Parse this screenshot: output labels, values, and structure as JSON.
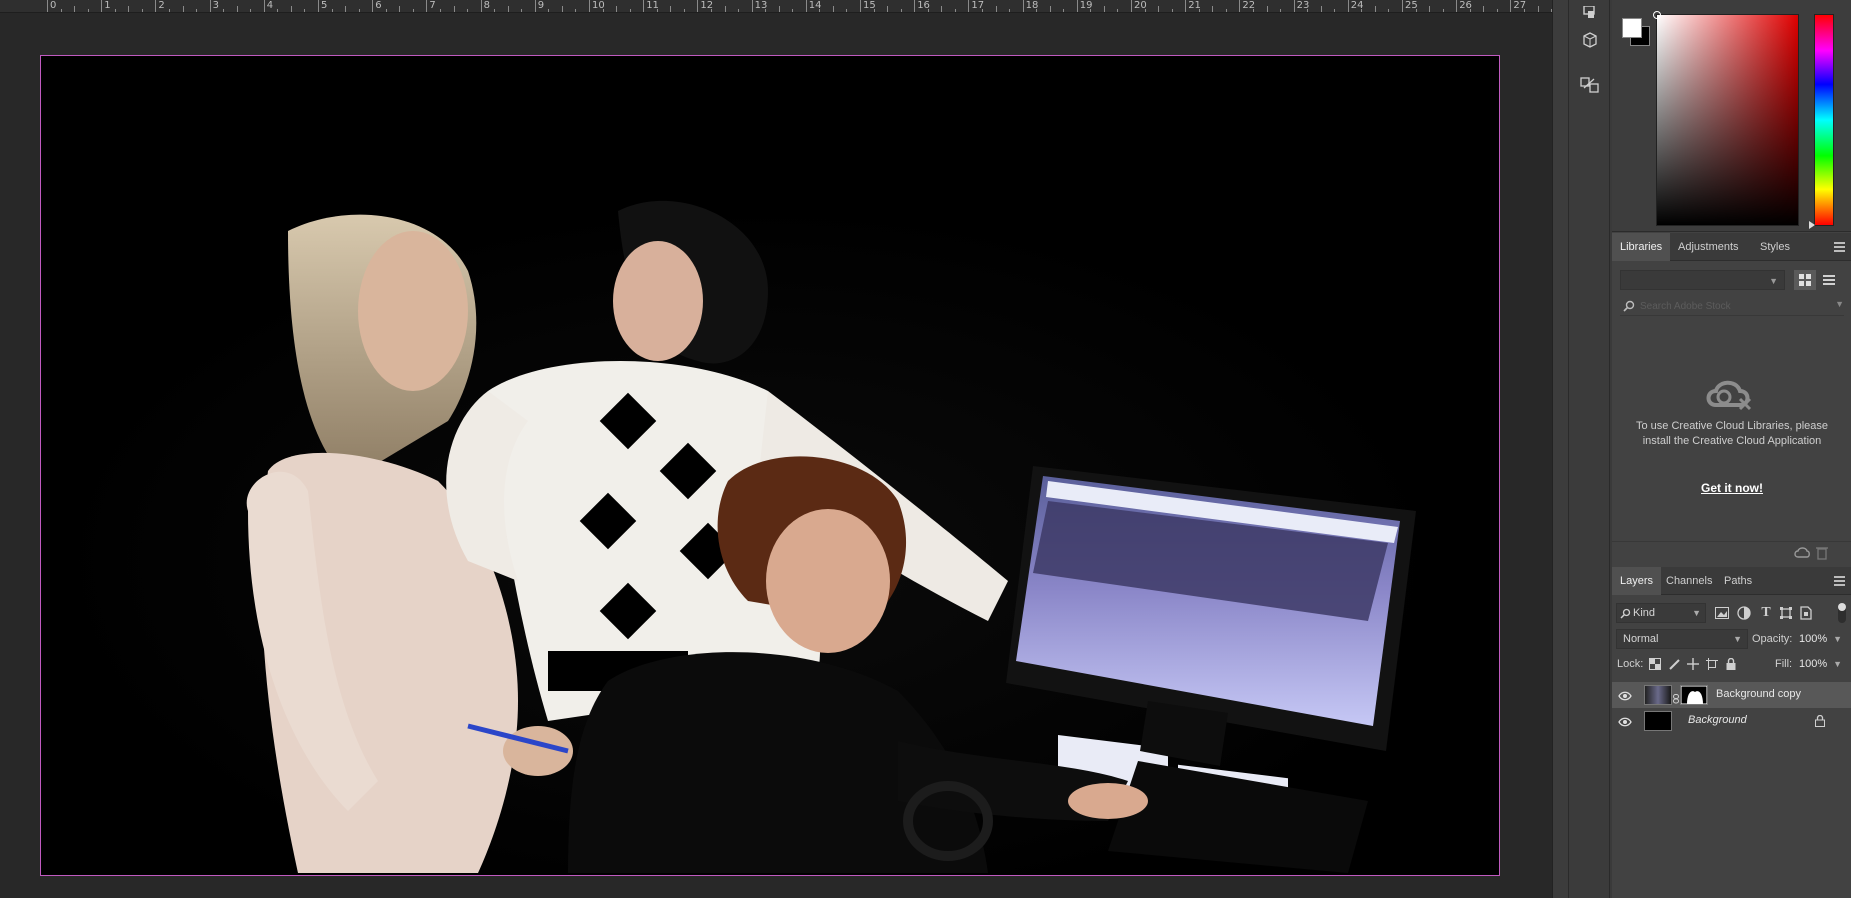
{
  "ruler": {
    "numbers": [
      "0",
      "1",
      "2",
      "3",
      "4",
      "5",
      "6",
      "7",
      "8",
      "9",
      "10",
      "11",
      "12",
      "13",
      "14",
      "15",
      "16",
      "17",
      "18",
      "19",
      "20",
      "21",
      "22",
      "23",
      "24",
      "25",
      "26",
      "27"
    ]
  },
  "document": {
    "image_description_icon": "photo-canvas"
  },
  "color_panel": {
    "foreground": "#ffffff",
    "background": "#000000",
    "hue_color": "#e00000"
  },
  "libraries_panel": {
    "tabs": [
      "Libraries",
      "Adjustments",
      "Styles"
    ],
    "active_tab": "Libraries",
    "search_placeholder": "Search Adobe Stock",
    "message": "To use Creative Cloud Libraries, please install the Creative Cloud Application",
    "cta": "Get it now!"
  },
  "layers_panel": {
    "tabs": [
      "Layers",
      "Channels",
      "Paths"
    ],
    "active_tab": "Layers",
    "kind_filter": "Kind",
    "blend_mode": "Normal",
    "opacity_label": "Opacity:",
    "opacity_value": "100%",
    "lock_label": "Lock:",
    "fill_label": "Fill:",
    "fill_value": "100%",
    "layers": [
      {
        "name": "Background copy",
        "visible": true,
        "selected": true,
        "italic": false,
        "locked": false
      },
      {
        "name": "Background",
        "visible": true,
        "selected": false,
        "italic": true,
        "locked": true
      }
    ]
  },
  "colors": {
    "accent_border": "#c05ac0",
    "panel_bg": "#424242",
    "canvas_bg": "#282828"
  }
}
